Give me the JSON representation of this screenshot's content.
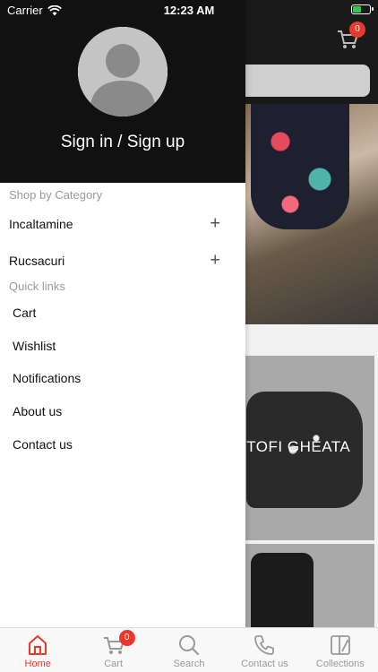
{
  "status_bar": {
    "carrier": "Carrier",
    "time": "12:23 AM"
  },
  "background": {
    "cart_badge": "0",
    "card_label": "ITOFI GHEATA"
  },
  "drawer": {
    "sign_in": "Sign in / Sign up",
    "shop_by_category_title": "Shop by Category",
    "categories": [
      {
        "label": "Incaltamine",
        "icon": "plus-icon"
      },
      {
        "label": "Rucsacuri",
        "icon": "plus-icon"
      }
    ],
    "quick_links_title": "Quick links",
    "quick_links": [
      "Cart",
      "Wishlist",
      "Notifications",
      "About us",
      "Contact us"
    ]
  },
  "tabbar": {
    "accent": "#e8392f",
    "tabs": [
      {
        "label": "Home",
        "icon": "home-icon",
        "active": true
      },
      {
        "label": "Cart",
        "icon": "cart-icon",
        "badge": "0"
      },
      {
        "label": "Search",
        "icon": "search-icon"
      },
      {
        "label": "Contact us",
        "icon": "phone-icon"
      },
      {
        "label": "Collections",
        "icon": "collections-icon"
      }
    ]
  }
}
